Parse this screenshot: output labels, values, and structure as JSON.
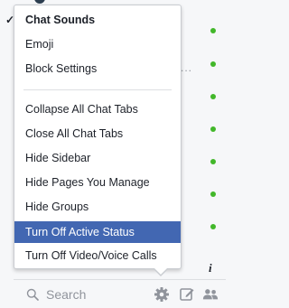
{
  "menu": {
    "items": [
      {
        "label": "Chat Sounds",
        "checked": true
      },
      {
        "label": "Emoji"
      },
      {
        "label": "Block Settings"
      },
      {
        "label": "Collapse All Chat Tabs"
      },
      {
        "label": "Close All Chat Tabs"
      },
      {
        "label": "Hide Sidebar"
      },
      {
        "label": "Hide Pages You Manage"
      },
      {
        "label": "Hide Groups"
      },
      {
        "label": "Turn Off Active Status",
        "highlighted": true
      },
      {
        "label": "Turn Off Video/Voice Calls"
      }
    ],
    "check_glyph": "✓"
  },
  "sidebar": {
    "ellipsis": "...",
    "partial_glyph": "i"
  },
  "search": {
    "placeholder": "Search"
  },
  "icons": [
    "search-icon",
    "gear-icon",
    "compose-icon",
    "people-icon",
    "check-icon"
  ],
  "colors": {
    "highlight": "#4267b2",
    "online": "#42b72a",
    "text": "#1d2129",
    "muted": "#90949c",
    "icon": "#90949c"
  }
}
